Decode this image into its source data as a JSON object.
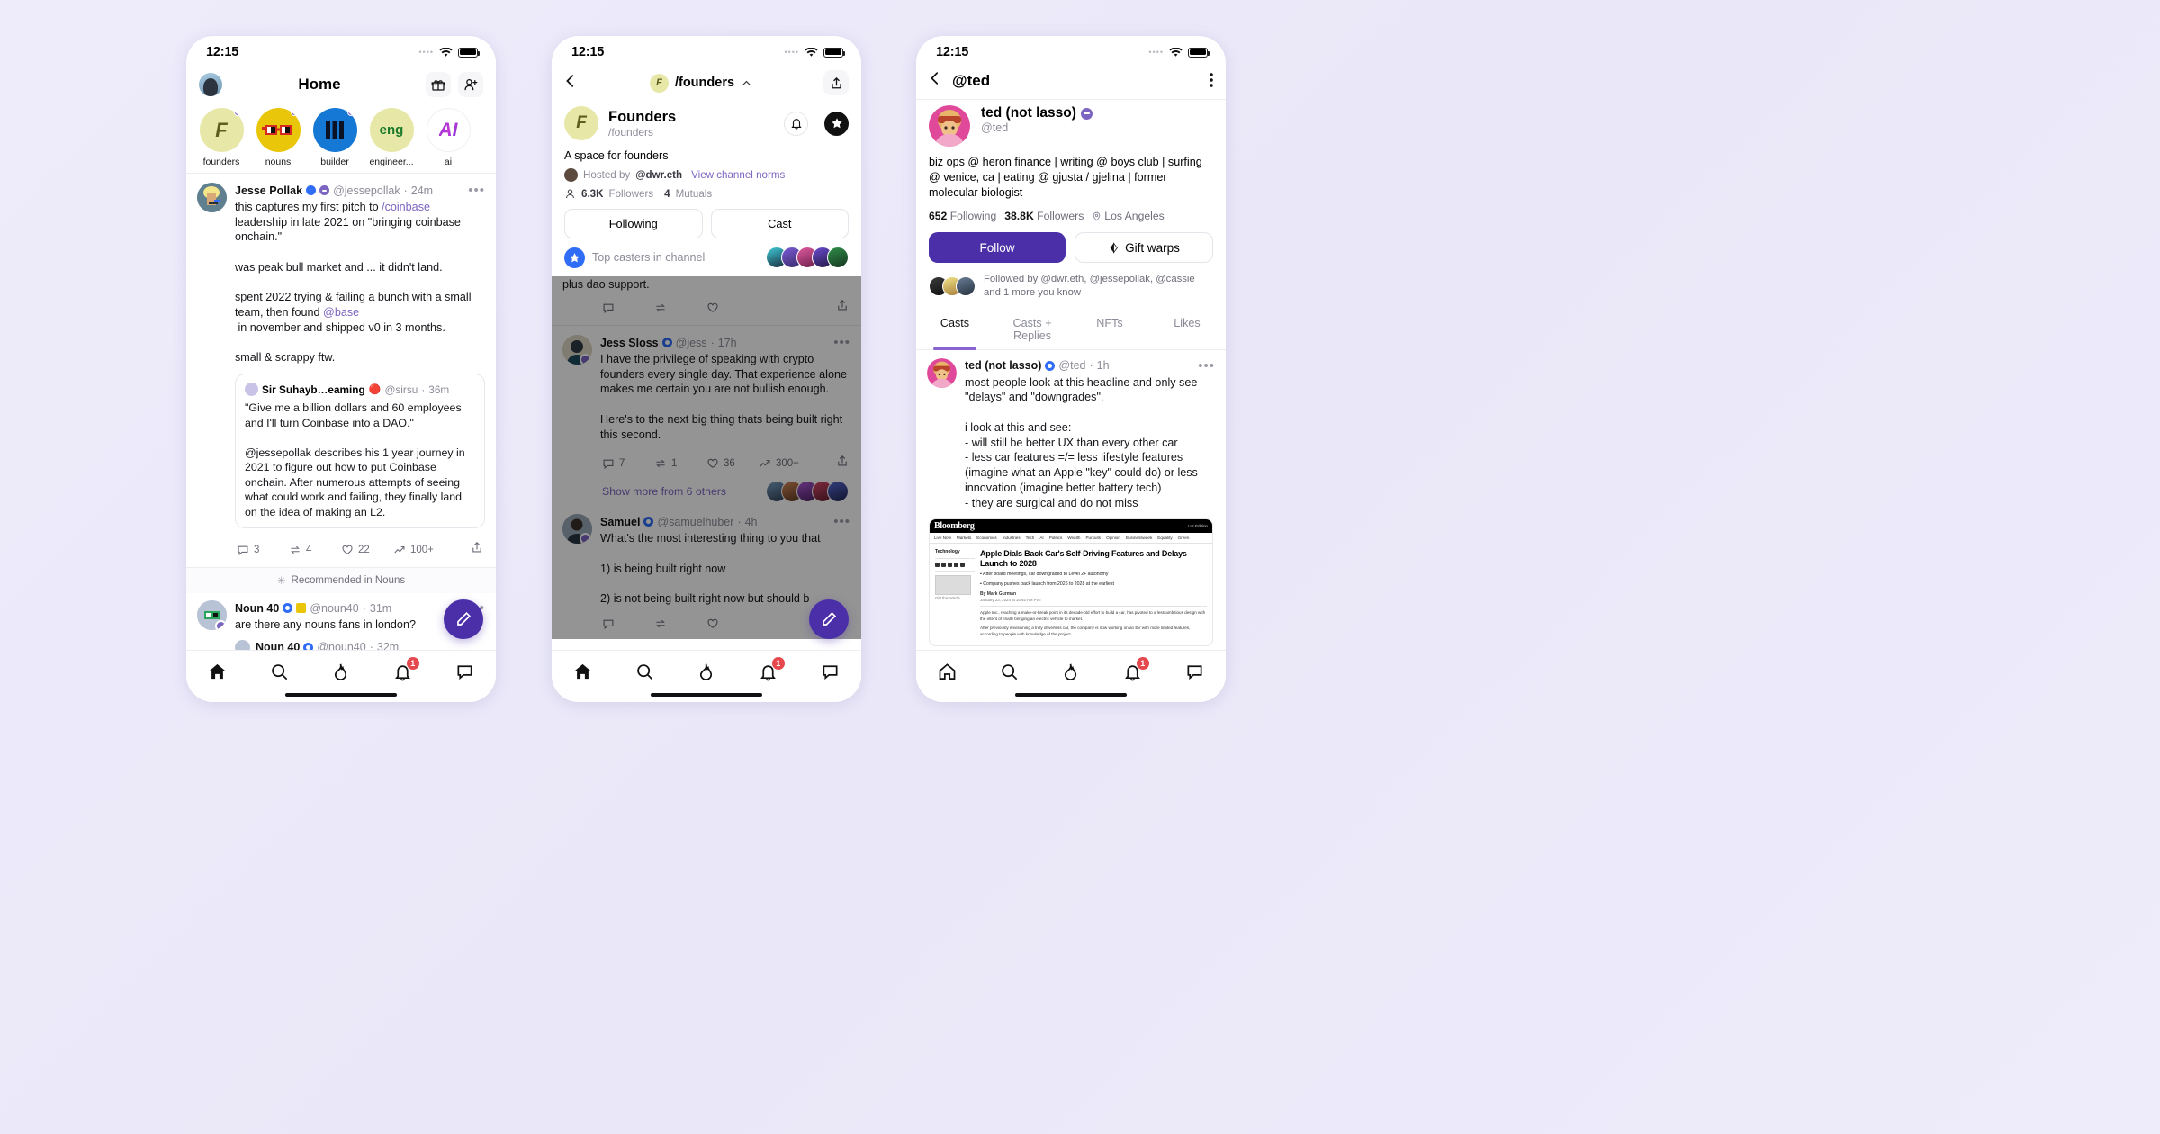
{
  "status": {
    "time": "12:15"
  },
  "phone1": {
    "header": {
      "title": "Home",
      "gift_icon": "gift-icon",
      "add_user_icon": "add-user-icon"
    },
    "channels": [
      {
        "name": "founders",
        "glyph": "F",
        "bg": "#e7e7a8",
        "fg": "#5d5d1d",
        "dot": true
      },
      {
        "name": "nouns",
        "glyph": "",
        "bg": "#e9c60a",
        "fg": "#000",
        "dot": true
      },
      {
        "name": "builder",
        "glyph": "",
        "bg": "#1578d4",
        "fg": "#fff",
        "dot": true
      },
      {
        "name": "engineer...",
        "glyph": "eng",
        "bg": "#e7e7a8",
        "fg": "#1b7a2a",
        "dot": false
      },
      {
        "name": "ai",
        "glyph": "AI",
        "bg": "#ffffff",
        "fg": "#9b3fd4",
        "dot": false
      }
    ],
    "cast": {
      "name": "Jesse Pollak",
      "handle": "@jessepollak",
      "time": "24m",
      "text_1": "this captures my first pitch to ",
      "link_1": "/coinbase",
      "text_2": "\nleadership in late 2021 on \"bringing coinbase onchain.\"\n\nwas peak bull market and ... it didn't land.\n\nspent 2022 trying & failing a bunch with a small team, then found ",
      "mention": "@base",
      "text_3": "\n in november and shipped v0 in 3 months.\n\nsmall & scrappy ftw.",
      "quote": {
        "name": "Sir Suhayb…eaming",
        "emoji": "🔴",
        "handle": "@sirsu",
        "time": "36m",
        "text": "\"Give me a billion dollars and 60 employees and I'll turn Coinbase into a DAO.\"\n\n@jessepollak describes his 1 year journey in 2021 to figure out how to put Coinbase onchain. After numerous attempts of seeing what could work and failing, they finally land on the idea of making an L2."
      },
      "actions": {
        "replies": "3",
        "recasts": "4",
        "likes": "22",
        "views": "100+"
      }
    },
    "recommended_label": "Recommended in Nouns",
    "rec_cast_1": {
      "name": "Noun 40",
      "handle": "@noun40",
      "time": "31m",
      "text": "are there any nouns fans in london?"
    },
    "rec_cast_2": {
      "name": "Noun 40",
      "handle": "@noun40",
      "time": "32m"
    },
    "tabbar": {
      "notifications_badge": "1"
    }
  },
  "phone2": {
    "nav": {
      "back_icon": "chevron-left-icon",
      "pill_label": "/founders",
      "chevron": "chevron-up-icon",
      "share_icon": "share-icon"
    },
    "channel": {
      "title": "Founders",
      "slug": "/founders",
      "description": "A space for founders",
      "hosted_label": "Hosted by",
      "host": "@dwr.eth",
      "norms_link": "View channel norms",
      "followers": "6.3K",
      "followers_label": "Followers",
      "mutuals": "4",
      "mutuals_label": "Mutuals",
      "glyph": "F"
    },
    "segments": [
      "Following",
      "Cast"
    ],
    "top_casters_label": "Top casters in channel",
    "casts": [
      {
        "name": "Jess Sloss",
        "handle": "@jess",
        "time": "17h",
        "text": "I have the privilege of speaking with crypto founders every single day. That experience alone makes me certain you are not bullish enough.\n\nHere's to the next big thing thats being built right this second.",
        "actions": {
          "replies": "7",
          "recasts": "1",
          "likes": "36",
          "views": "300+"
        },
        "show_more": "Show more from 6 others"
      },
      {
        "name": "Samuel",
        "handle": "@samuelhuber",
        "time": "4h",
        "text": "What's the most interesting thing to you that\n\n1) is being built right now\n\n2) is not being built right now but should b"
      }
    ],
    "cut_text": "plus dao support.",
    "tabbar": {
      "notifications_badge": "1"
    }
  },
  "phone3": {
    "nav": {
      "back_icon": "chevron-left-icon",
      "title": "@ted",
      "menu_icon": "kebab-menu-icon"
    },
    "profile": {
      "display_name": "ted (not lasso)",
      "handle": "@ted",
      "bio": "biz ops @ heron finance | writing @ boys club | surfing @ venice, ca | eating @ gjusta / gjelina | former molecular biologist",
      "following_count": "652",
      "following_label": "Following",
      "followers_count": "38.8K",
      "followers_label": "Followers",
      "location": "Los Angeles",
      "follow_button": "Follow",
      "gift_button": "Gift warps",
      "followed_by": "Followed by @dwr.eth, @jessepollak, @cassie and 1 more you know"
    },
    "tabs": [
      "Casts",
      "Casts + Replies",
      "NFTs",
      "Likes"
    ],
    "cast": {
      "name": "ted (not lasso)",
      "handle": "@ted",
      "time": "1h",
      "text": "most people look at this headline and only see \"delays\" and \"downgrades\".\n\ni look at this and see:\n- will still be better UX than every other car\n- less car features =/= less lifestyle features (imagine what an Apple \"key\" could do) or less innovation (imagine better battery tech)\n- they are surgical and do not miss"
    },
    "news": {
      "brand": "Bloomberg",
      "subscribe": "US Edition",
      "nav": [
        "Live Now",
        "Markets",
        "Economics",
        "Industries",
        "Tech",
        "AI",
        "Politics",
        "Wealth",
        "Pursuits",
        "Opinion",
        "Businessweek",
        "Equality",
        "Green"
      ],
      "category": "Technology",
      "headline": "Apple Dials Back Car's Self-Driving Features and Delays Launch to 2028",
      "bullets": [
        "After board meetings, car downgraded to Level 2+ autonomy",
        "Company pushes back launch from 2026 to 2028 at the earliest"
      ],
      "byline": "By Mark Gurman",
      "date": "January 23, 2024 at 10:40 AM PST",
      "paragraph_1": "Apple Inc., reaching a make-or-break point in its decade-old effort to build a car, has pivoted to a less ambitious design with the intent of finally bringing an electric vehicle to market.",
      "paragraph_2": "After previously envisioning a truly driverless car, the company is now working on an EV with more limited features, according to people with knowledge of the project."
    },
    "tabbar": {
      "notifications_badge": "1"
    }
  },
  "colors": {
    "accent_purple": "#7c65c1",
    "deep_purple": "#4a2fa8",
    "badge_red": "#e5484d",
    "link_blue": "#2f6df6",
    "page_bg": "#ecebfa"
  }
}
